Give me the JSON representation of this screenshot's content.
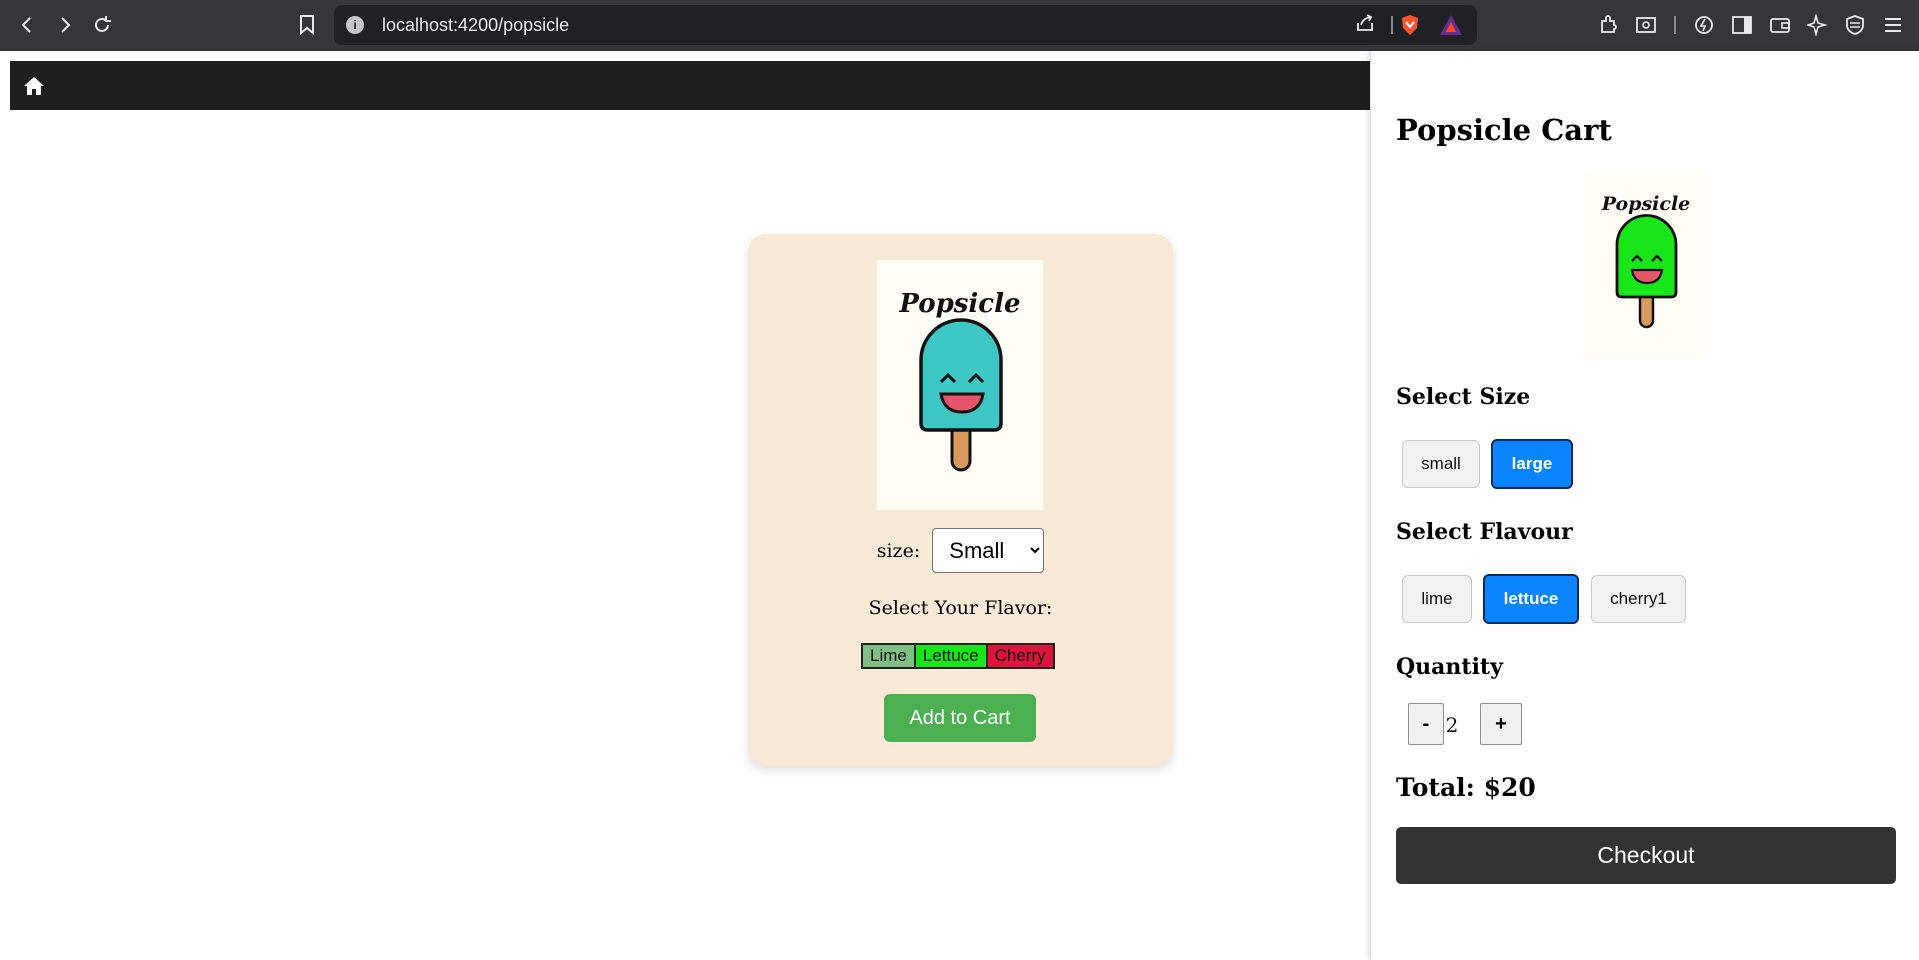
{
  "browser": {
    "url": "localhost:4200/popsicle"
  },
  "product": {
    "image_text": "Popsicle",
    "size_label": "size:",
    "size_selected": "Small",
    "flavor_title": "Select Your Flavor:",
    "flavors": [
      {
        "label": "Lime",
        "color": "#7fbf86"
      },
      {
        "label": "Lettuce",
        "color": "#19e619"
      },
      {
        "label": "Cherry",
        "color": "#dc143c"
      }
    ],
    "add_button": "Add to Cart",
    "popsicle_color": "#3dc7c4"
  },
  "cart": {
    "title": "Popsicle Cart",
    "image_text": "Popsicle",
    "popsicle_color": "#19e619",
    "size_heading": "Select Size",
    "sizes": [
      "small",
      "large"
    ],
    "selected_size": "large",
    "flavour_heading": "Select Flavour",
    "flavours": [
      "lime",
      "lettuce",
      "cherry1"
    ],
    "selected_flavour": "lettuce",
    "quantity_heading": "Quantity",
    "minus": "-",
    "plus": "+",
    "quantity": "2",
    "total": "Total: $20",
    "checkout": "Checkout"
  }
}
